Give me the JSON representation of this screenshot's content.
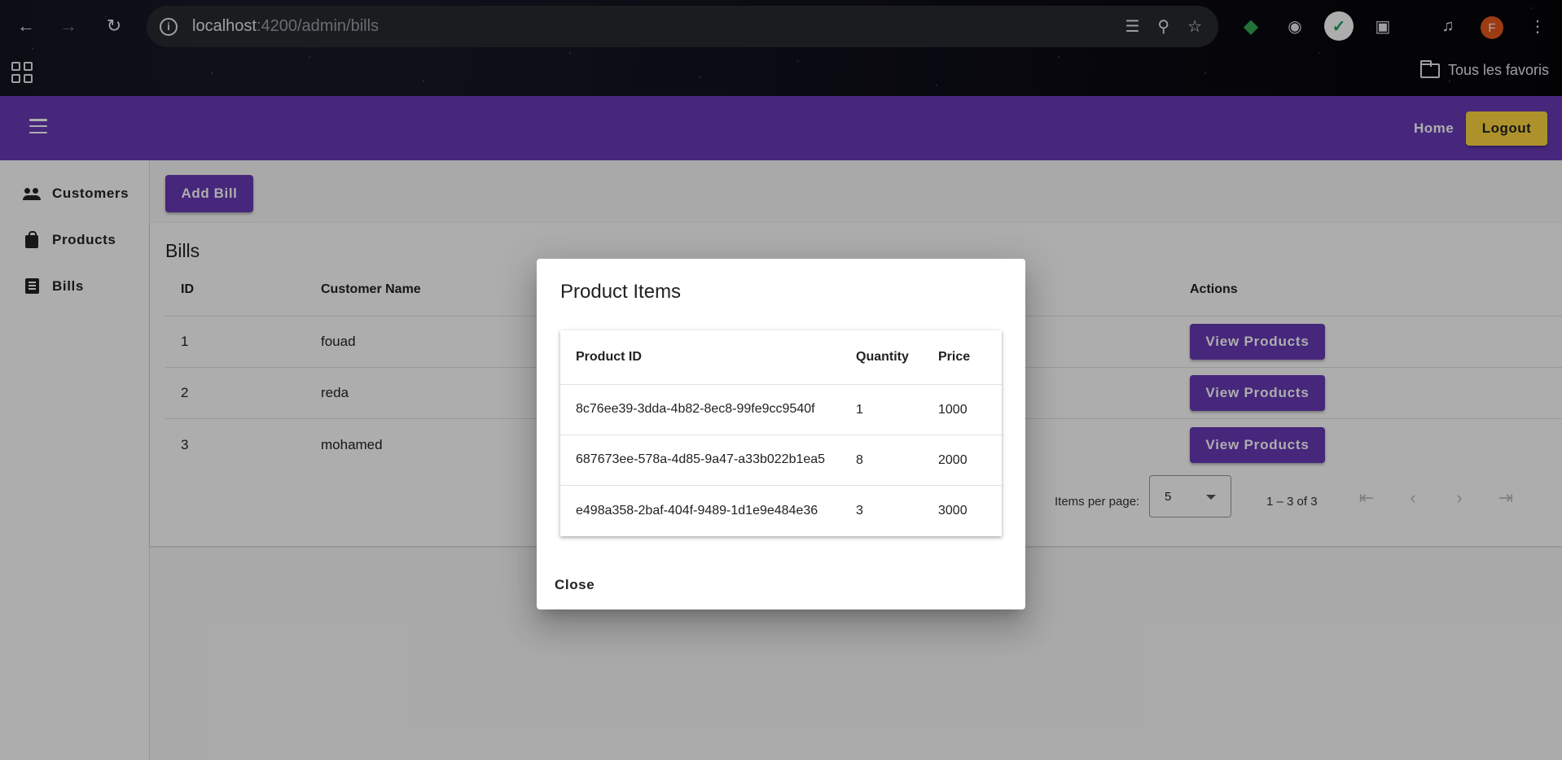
{
  "browser": {
    "url_host": "localhost",
    "url_rest": ":4200/admin/bills",
    "profile_initial": "F",
    "bookmarks_label": "Tous les favoris"
  },
  "toolbar": {
    "home_label": "Home",
    "logout_label": "Logout",
    "accent_color": "#673ab7",
    "logout_color": "#ffd740"
  },
  "sidebar": {
    "items": [
      {
        "label": "Customers",
        "icon": "people-icon"
      },
      {
        "label": "Products",
        "icon": "shopping-bag-icon"
      },
      {
        "label": "Bills",
        "icon": "receipt-list-icon"
      }
    ]
  },
  "page": {
    "add_bill_label": "Add Bill",
    "bills_title": "Bills",
    "columns": {
      "id": "ID",
      "customer": "Customer Name",
      "actions": "Actions"
    },
    "rows": [
      {
        "id": "1",
        "customer": "fouad",
        "action": "View Products"
      },
      {
        "id": "2",
        "customer": "reda",
        "action": "View Products"
      },
      {
        "id": "3",
        "customer": "mohamed",
        "action": "View Products"
      }
    ],
    "paginator": {
      "items_per_page_label": "Items per page:",
      "page_size": "5",
      "range_label": "1 – 3 of 3"
    }
  },
  "dialog": {
    "title": "Product Items",
    "columns": {
      "product_id": "Product ID",
      "quantity": "Quantity",
      "price": "Price"
    },
    "rows": [
      {
        "product_id": "8c76ee39-3dda-4b82-8ec8-99fe9cc9540f",
        "quantity": "1",
        "price": "1000"
      },
      {
        "product_id": "687673ee-578a-4d85-9a47-a33b022b1ea5",
        "quantity": "8",
        "price": "2000"
      },
      {
        "product_id": "e498a358-2baf-404f-9489-1d1e9e484e36",
        "quantity": "3",
        "price": "3000"
      }
    ],
    "close_label": "Close"
  }
}
